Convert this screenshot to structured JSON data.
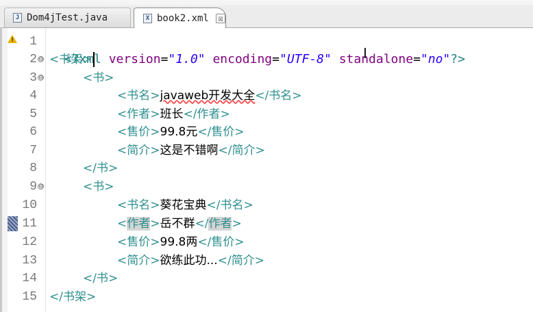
{
  "tabs": [
    {
      "label": "Dom4jTest.java",
      "icon": "java-file-icon",
      "active": false
    },
    {
      "label": "book2.xml",
      "icon": "xml-file-icon",
      "active": true,
      "close": "☒"
    }
  ],
  "gutter": {
    "line_numbers": [
      "1",
      "2",
      "3",
      "4",
      "5",
      "6",
      "7",
      "8",
      "9",
      "10",
      "11",
      "12",
      "13",
      "14",
      "15"
    ],
    "fold_markers": [
      "⊖",
      "⊖",
      "⊖"
    ]
  },
  "xml": {
    "decl_open": "<?xml",
    "version_attr": "version",
    "eq": "=",
    "version_val": "\"1.0\"",
    "encoding_attr": "encoding",
    "encoding_val": "\"UTF-8\"",
    "standalone_attr": "standalone",
    "standalone_val": "\"no\"",
    "decl_close": "?>",
    "root_open": "<书架>",
    "root_close": "</书架>",
    "book_open": "<书>",
    "book_close": "</书>",
    "name_open": "<书名>",
    "name_close": "</书名>",
    "author_open": "<作者>",
    "author_close": "</作者>",
    "price_open": "<售价>",
    "price_close": "</售价>",
    "intro_open": "<简介>",
    "intro_close": "</简介>",
    "lt": "<",
    "lt_slash": "</",
    "gt": ">",
    "author_tag": "作者",
    "book1": {
      "name": "javaweb开发大全",
      "author": "班长",
      "price": "99.8元",
      "intro": "这是不错啊"
    },
    "book2": {
      "name": "葵花宝典",
      "author": "岳不群",
      "price": "99.8两",
      "intro": "欲练此功..."
    }
  }
}
